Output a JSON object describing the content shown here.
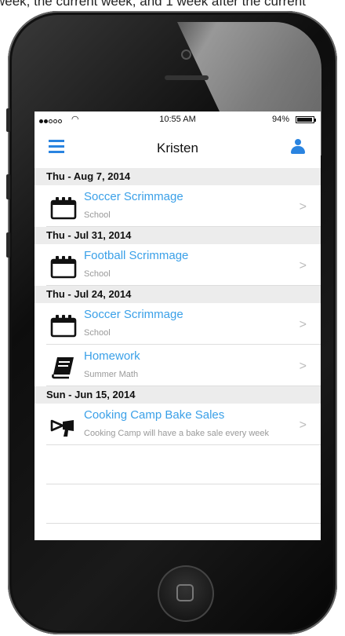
{
  "caption": "week, the current week, and 1 week after the current",
  "status_bar": {
    "time": "10:55 AM",
    "battery": "94%"
  },
  "navbar": {
    "title": "Kristen"
  },
  "groups": [
    {
      "date": "Thu - Aug 7, 2014",
      "items": [
        {
          "title": "Soccer Scrimmage",
          "subtitle": "School",
          "icon": "calendar-icon"
        }
      ]
    },
    {
      "date": "Thu - Jul 31, 2014",
      "items": [
        {
          "title": "Football Scrimmage",
          "subtitle": "School",
          "icon": "calendar-icon"
        }
      ]
    },
    {
      "date": "Thu - Jul 24, 2014",
      "items": [
        {
          "title": "Soccer Scrimmage",
          "subtitle": "School",
          "icon": "calendar-icon"
        },
        {
          "title": "Homework",
          "subtitle": "Summer Math",
          "icon": "book-icon"
        }
      ]
    },
    {
      "date": "Sun - Jun 15, 2014",
      "items": [
        {
          "title": "Cooking Camp Bake Sales",
          "subtitle": "Cooking Camp will have a bake sale every week",
          "icon": "megaphone-icon"
        }
      ]
    }
  ],
  "colors": {
    "accent": "#2a84e0",
    "link": "#3aa0e8",
    "section_bg": "#ececec"
  }
}
